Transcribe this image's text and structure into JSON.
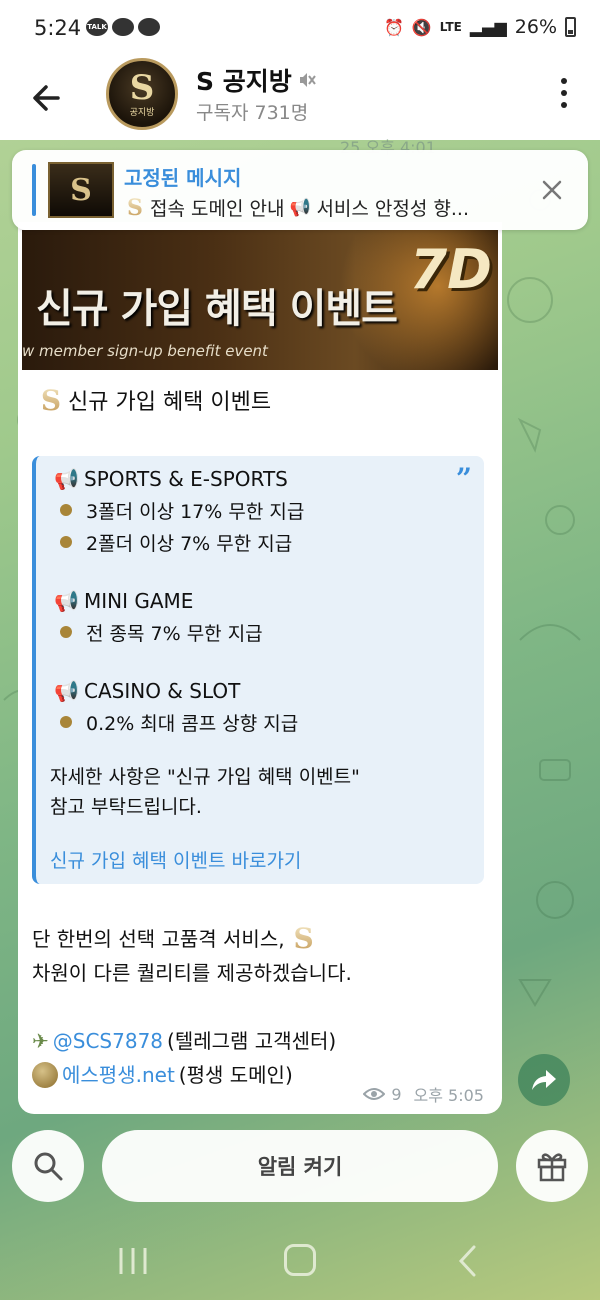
{
  "status_bar": {
    "time": "5:24",
    "talk_badge": "TALK",
    "network": "LTE",
    "battery": "26%"
  },
  "header": {
    "title": "S 공지방",
    "subtitle": "구독자 731명",
    "avatar_letter": "S",
    "avatar_sub": "공지방"
  },
  "previous_message_meta": "25  오후 4:01",
  "pinned": {
    "label": "고정된 메시지",
    "text_part1": "접속 도메인 안내",
    "text_part2": "서비스 안정성 향..."
  },
  "message": {
    "banner": {
      "title": "신규 가입 혜택 이벤트",
      "subtitle": "w member sign-up benefit event",
      "badge": "7D"
    },
    "headline": "신규 가입 혜택 이벤트",
    "quote": {
      "sections": [
        {
          "title": "SPORTS & E-SPORTS",
          "items": [
            "3폴더 이상 17% 무한 지급",
            "2폴더 이상 7% 무한 지급"
          ]
        },
        {
          "title": "MINI GAME",
          "items": [
            "전 종목 7% 무한 지급"
          ]
        },
        {
          "title": "CASINO & SLOT",
          "items": [
            "0.2% 최대 콤프 상향 지급"
          ]
        }
      ],
      "note_line1": "자세한 사항은 \"신규 가입 혜택 이벤트\"",
      "note_line2": "참고 부탁드립니다.",
      "link": "신규 가입 혜택 이벤트 바로가기"
    },
    "outro_line1": "단 한번의 선택 고품격 서비스,",
    "outro_line2": "차원이 다른 퀄리티를 제공하겠습니다.",
    "telegram_handle": "@SCS7878",
    "telegram_desc": "(텔레그램 고객센터)",
    "domain_link": "에스평생.net",
    "domain_desc": "(평생 도메인)",
    "views": "9",
    "time": "오후 5:05"
  },
  "bottom_bar": {
    "notify_label": "알림 켜기"
  },
  "colors": {
    "accent": "#3a8edb",
    "bullet": "#a88538",
    "bubble": "#ffffff"
  }
}
